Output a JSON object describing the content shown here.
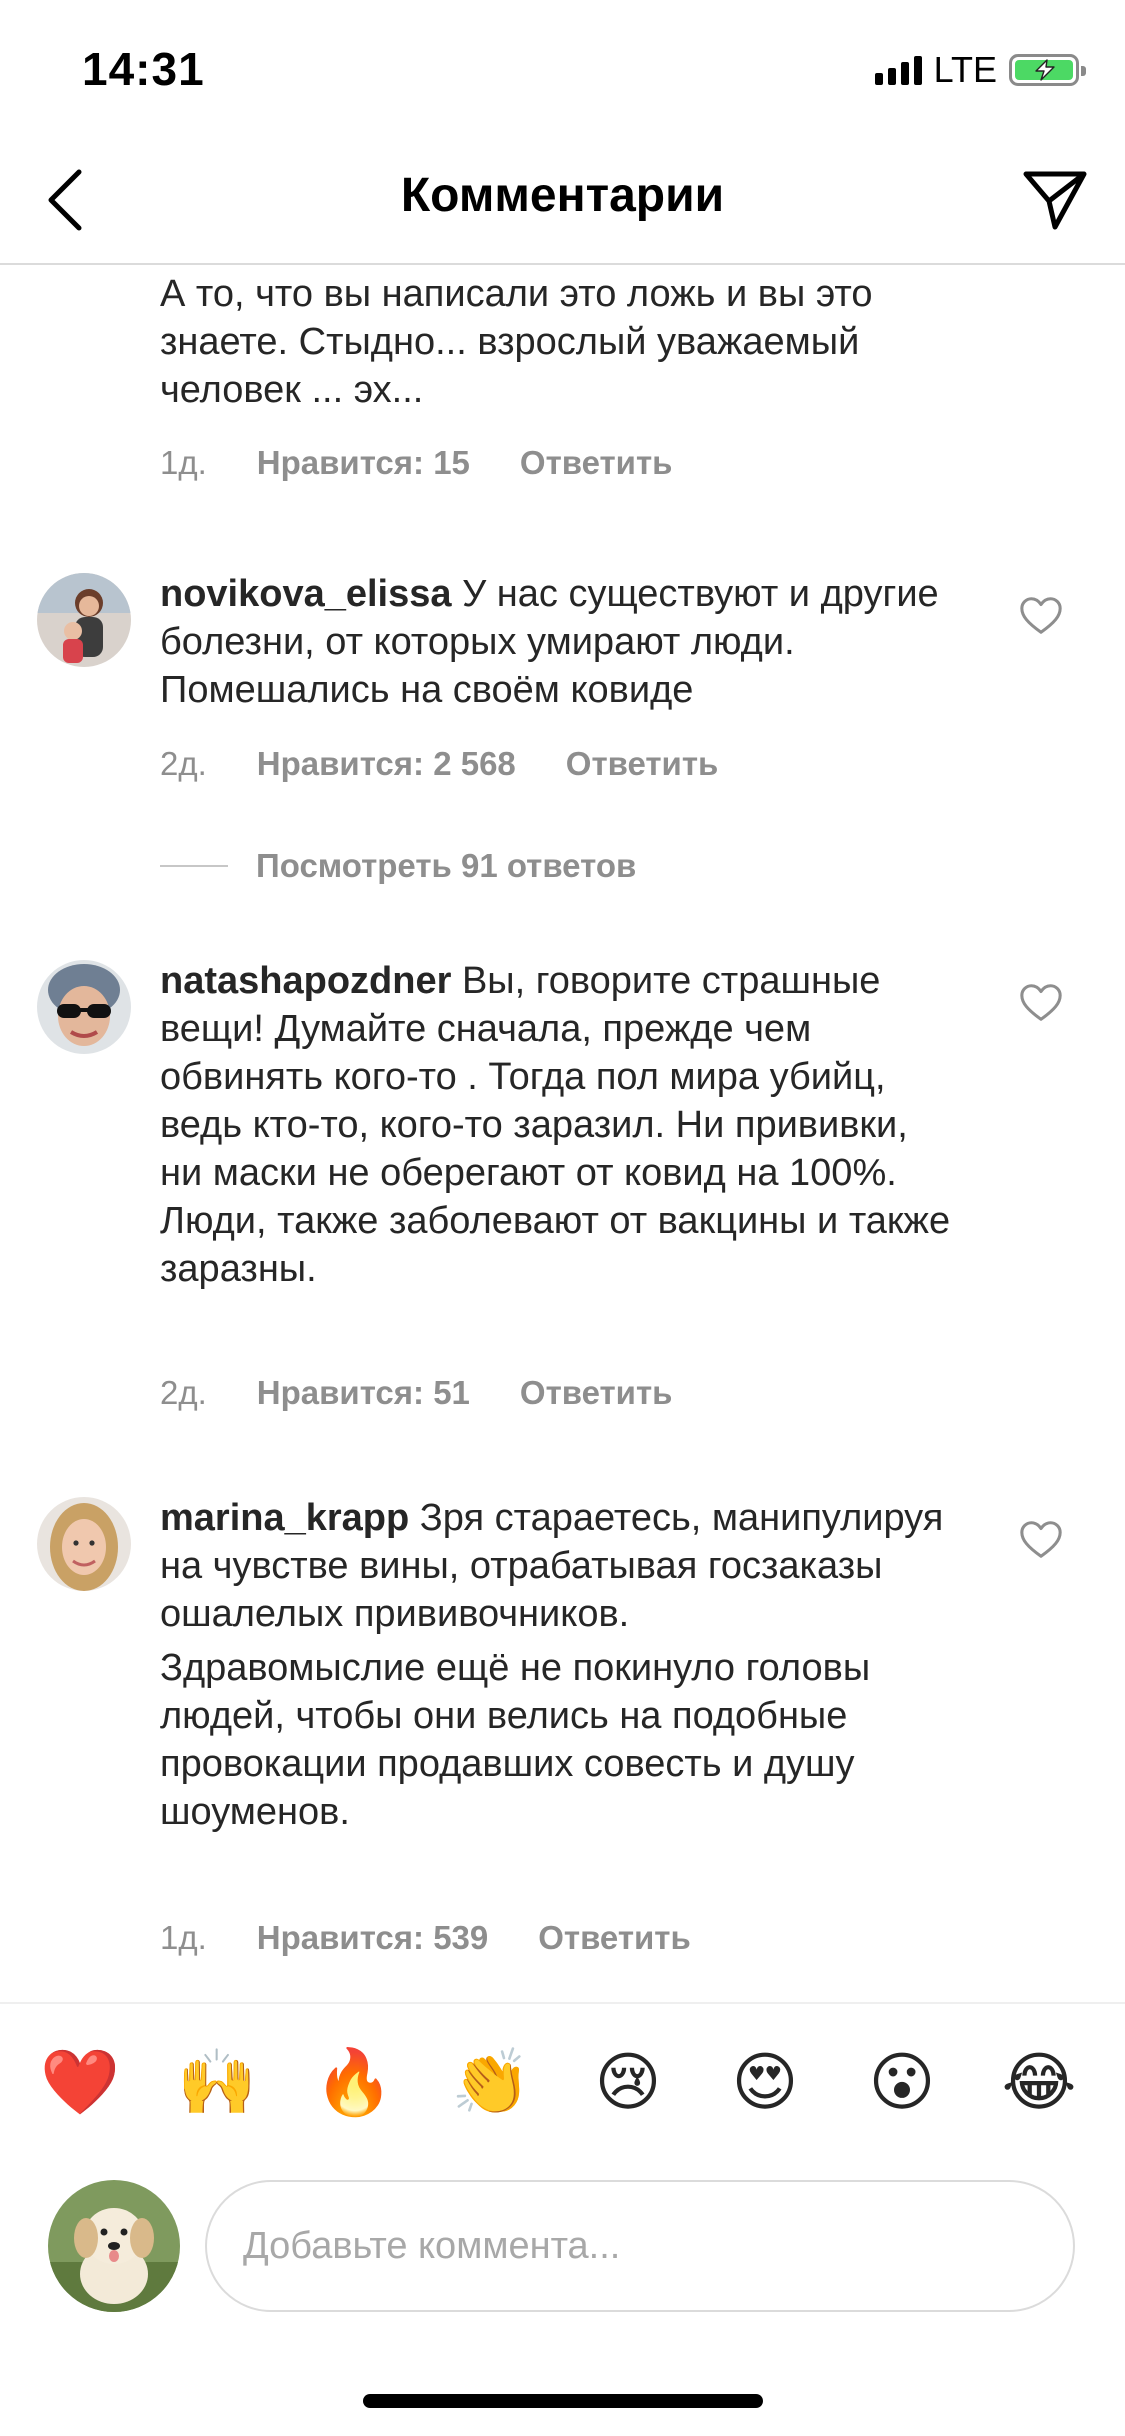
{
  "status_bar": {
    "time": "14:31",
    "network": "LTE"
  },
  "header": {
    "title": "Комментарии"
  },
  "comments": [
    {
      "username": "",
      "paragraphs": [
        "А то, что вы написали это ложь и вы это знаете. Стыдно... взрослый уважаемый человек ... эх..."
      ],
      "time": "1д.",
      "likes": "Нравится: 15",
      "reply": "Ответить"
    },
    {
      "username": "novikova_elissa",
      "paragraphs": [
        "У нас существуют и другие болезни, от которых умирают люди. Помешались на своём ковиде"
      ],
      "time": "2д.",
      "likes": "Нравится: 2 568",
      "reply": "Ответить",
      "view_replies": "Посмотреть 91 ответов"
    },
    {
      "username": "natashapozdner",
      "paragraphs": [
        "Вы, говорите страшные вещи! Думайте сначала, прежде чем обвинять кого-то . Тогда пол мира убийц, ведь кто-то, кого-то заразил. Ни прививки, ни маски не оберегают от ковид на 100%. Люди, также заболевают от вакцины и также заразны."
      ],
      "time": "2д.",
      "likes": "Нравится: 51",
      "reply": "Ответить"
    },
    {
      "username": "marina_krapp",
      "paragraphs": [
        "Зря стараетесь, манипулируя на чувстве вины, отрабатывая госзаказы ошалелых прививочников.",
        "Здравомыслие ещё не покинуло головы людей, чтобы они велись на подобные провокации продавших совесть и душу шоуменов."
      ],
      "time": "1д.",
      "likes": "Нравится: 539",
      "reply": "Ответить"
    }
  ],
  "emoji_bar": [
    "❤️",
    "🙌",
    "🔥",
    "👏",
    "😢",
    "😍",
    "😮",
    "😂"
  ],
  "compose": {
    "placeholder": "Добавьте коммента..."
  },
  "icons": {
    "back": "chevron-left-icon",
    "send": "paper-plane-icon",
    "like": "heart-outline-icon"
  },
  "colors": {
    "text": "#262626",
    "secondary": "#8e8e8e",
    "divider": "#dbdbdb",
    "battery": "#4cd964"
  }
}
